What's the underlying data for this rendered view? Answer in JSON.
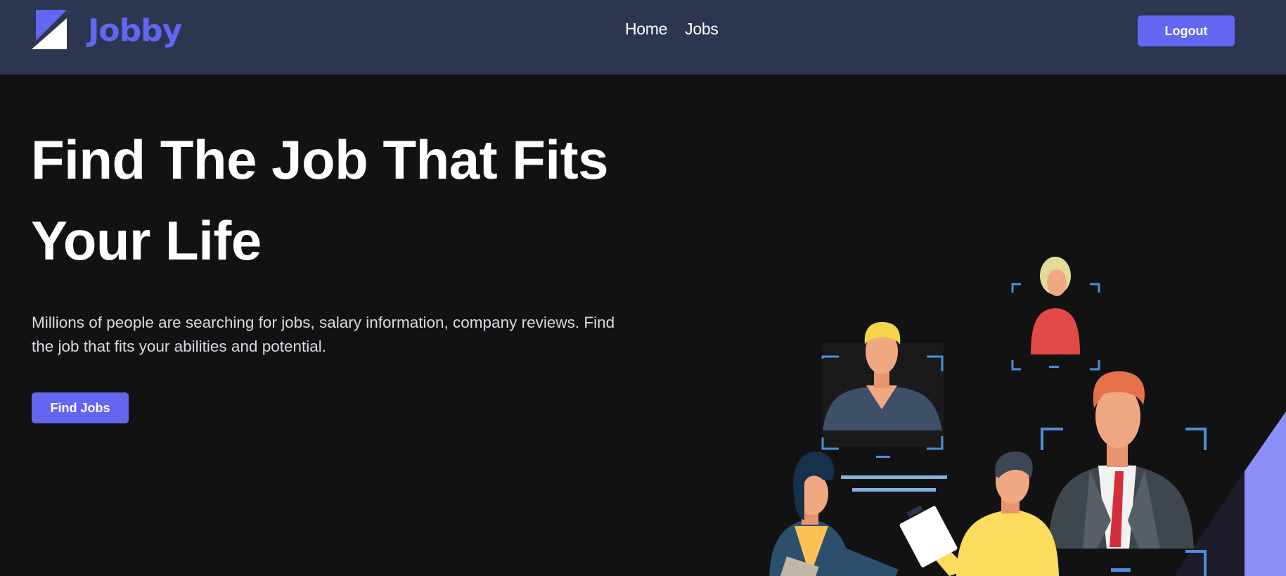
{
  "header": {
    "logo_text": "Jobby",
    "nav": {
      "home": "Home",
      "jobs": "Jobs"
    },
    "logout_label": "Logout"
  },
  "hero": {
    "title": "Find The Job That Fits Your Life",
    "description": "Millions of people are searching for jobs, salary information, company reviews. Find the job that fits your abilities and potential.",
    "cta_label": "Find Jobs"
  },
  "colors": {
    "navbar": "#2c3651",
    "background": "#121212",
    "accent": "#6366f1",
    "frame": "#4a90d9"
  },
  "illustration": {
    "icon": "job-recruitment-illustration"
  }
}
